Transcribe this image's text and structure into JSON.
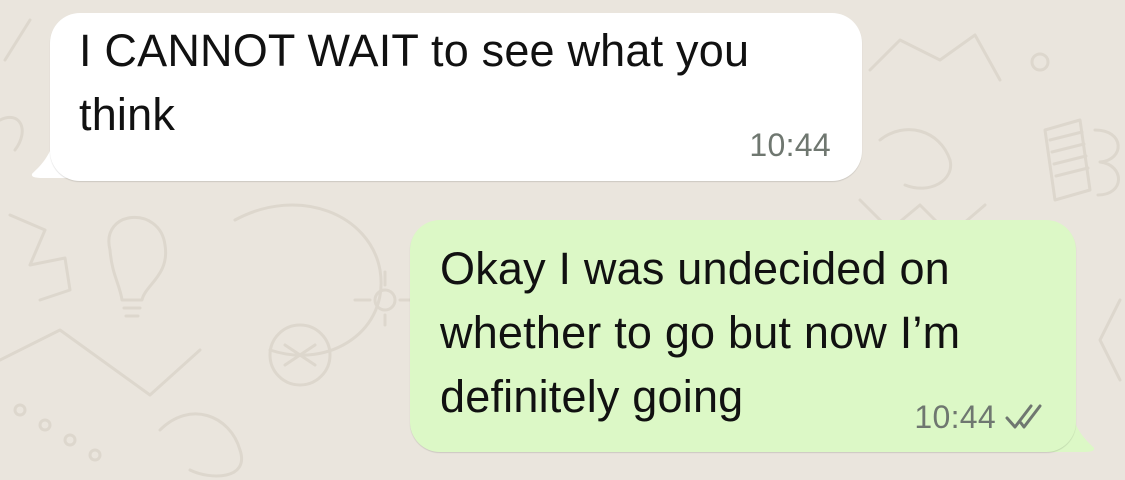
{
  "chat": {
    "colors": {
      "background": "#EAE5DD",
      "incoming_bubble": "#FFFFFF",
      "outgoing_bubble": "#DCF8C6",
      "text": "#111111",
      "timestamp": "#6F7770",
      "read_ticks": "#6F7770"
    },
    "messages": [
      {
        "direction": "incoming",
        "text": "I CANNOT WAIT to see what you\nthink",
        "time": "10:44"
      },
      {
        "direction": "outgoing",
        "text": "Okay I was undecided on\nwhether to go but now I’m\ndefinitely going",
        "time": "10:44",
        "status_icon": "double-check-icon"
      }
    ]
  }
}
